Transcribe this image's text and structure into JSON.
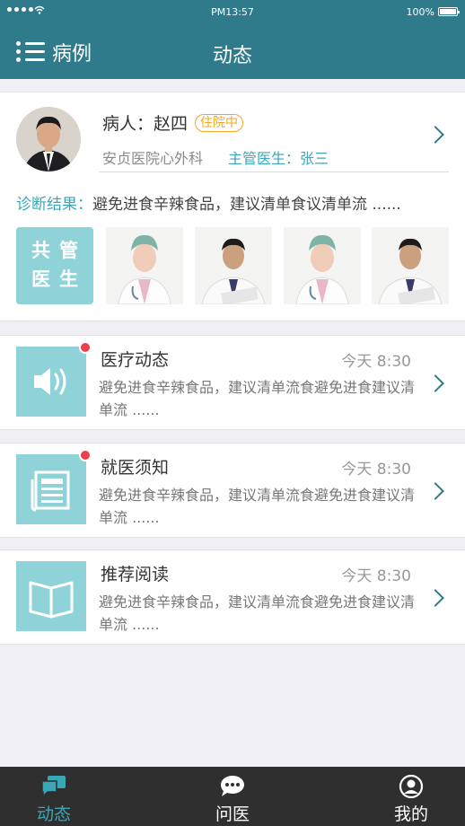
{
  "status_bar": {
    "time": "PM13:57",
    "battery": "100%"
  },
  "nav": {
    "menu_label": "病例",
    "title": "动态"
  },
  "patient": {
    "name_label": "病人：赵四",
    "status_badge": "住院中",
    "department": "安贞医院心外科",
    "doctor_label": "主管医生：张三",
    "diagnosis_key": "诊断结果：",
    "diagnosis_text": "避免进食辛辣食品，建议清单食议清单流 ......",
    "cotreat_label": "共管医生"
  },
  "feed": [
    {
      "title": "医疗动态",
      "time": "今天 8:30",
      "text": "避免进食辛辣食品，建议清单流食避免进食建议清单流 ......",
      "icon": "speaker-icon",
      "unread": true
    },
    {
      "title": "就医须知",
      "time": "今天 8:30",
      "text": "避免进食辛辣食品，建议清单流食避免进食建议清单流 ......",
      "icon": "newspaper-icon",
      "unread": true
    },
    {
      "title": "推荐阅读",
      "time": "今天 8:30",
      "text": "避免进食辛辣食品，建议清单流食避免进食建议清单流 ......",
      "icon": "book-icon",
      "unread": false
    }
  ],
  "tabbar": {
    "tabs": [
      {
        "label": "动态",
        "icon": "chat-bubbles-icon",
        "active": true
      },
      {
        "label": "问医",
        "icon": "chat-dots-icon",
        "active": false
      },
      {
        "label": "我的",
        "icon": "user-icon",
        "active": false
      }
    ]
  },
  "colors": {
    "primary": "#2f7a8b",
    "accent": "#3aa7b6",
    "tile": "#8fd3d8",
    "badge": "#f5a623",
    "unread_dot": "#ef3f4f",
    "tabbar_bg": "#2f2f2f"
  }
}
